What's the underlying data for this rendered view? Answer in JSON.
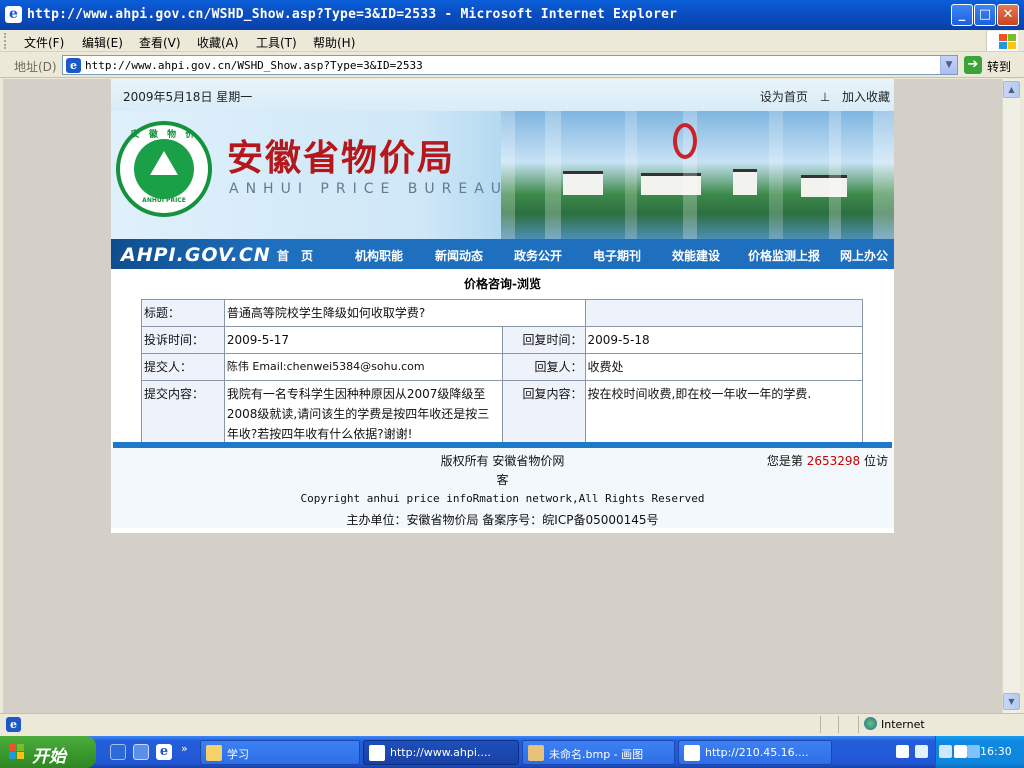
{
  "window": {
    "title": "http://www.ahpi.gov.cn/WSHD_Show.asp?Type=3&ID=2533 - Microsoft Internet Explorer"
  },
  "menu": [
    "文件(F)",
    "编辑(E)",
    "查看(V)",
    "收藏(A)",
    "工具(T)",
    "帮助(H)"
  ],
  "address": {
    "label": "地址(D)",
    "url": "http://www.ahpi.gov.cn/WSHD_Show.asp?Type=3&ID=2533",
    "go": "转到"
  },
  "site": {
    "date": "2009年5月18日 星期一",
    "set_home": "设为首页",
    "divider": "⊥",
    "add_fav": "加入收藏",
    "title_cn": "安徽省物价局",
    "title_en": "ANHUI PRICE BUREAU",
    "seal_top": "安 徽 物 价",
    "seal_bottom": "ANHUI PRICE",
    "domain_logo": "AHPI.GOV.CN",
    "nav": [
      "首　页",
      "机构职能",
      "新闻动态",
      "政务公开",
      "电子期刊",
      "效能建设",
      "价格监测上报",
      "网上办公"
    ]
  },
  "detail": {
    "heading": "价格咨询-浏览",
    "subject_label": "标题：",
    "subject": "普通高等院校学生降级如何收取学费?",
    "complaint_time_label": "投诉时间：",
    "complaint_time": "2009-5-17",
    "reply_time_label": "回复时间：",
    "reply_time": "2009-5-18",
    "submitter_label": "提交人：",
    "submitter": "陈伟 Email:chenwei5384@sohu.com",
    "replier_label": "回复人：",
    "replier": "收费处",
    "content_label": "提交内容：",
    "content": "我院有一名专科学生因种种原因从2007级降级至2008级就读,请问该生的学费是按四年收还是按三年收?若按四年收有什么依据?谢谢!",
    "reply_label": "回复内容：",
    "reply": "按在校时间收费,即在校一年收一年的学费."
  },
  "footer": {
    "copyright_cn": "版权所有 安徽省物价网",
    "visitor_prefix": "您是第",
    "visitor_count": "2653298",
    "visitor_suffix": "位访",
    "visitor_wrap": "客",
    "copyright_en": "Copyright anhui price infoRmation network,All Rights Reserved",
    "sponsor": "主办单位：安徽省物价局 备案序号：皖ICP备05000145号"
  },
  "status": {
    "zone": "Internet"
  },
  "taskbar": {
    "start": "开始",
    "tasks": [
      "学习",
      "http://www.ahpi....",
      "未命名.bmp - 画图",
      "http://210.45.16...."
    ],
    "clock": "16:30"
  },
  "colors": {
    "nav_bg": "#1f6fbf",
    "title_red": "#b5181b",
    "counter_red": "#cc0000"
  },
  "icons": [
    "ie-icon",
    "minimize-icon",
    "maximize-icon",
    "close-icon",
    "windows-logo-icon",
    "go-arrow-icon",
    "dropdown-arrow-icon",
    "folder-icon",
    "paint-icon",
    "globe-icon",
    "volume-icon",
    "network-icon",
    "help-icon"
  ]
}
